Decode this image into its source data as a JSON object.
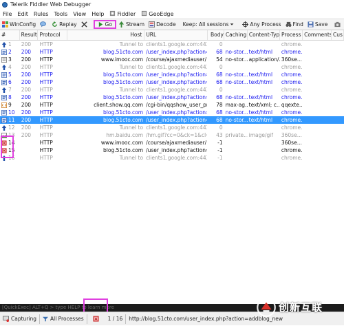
{
  "window": {
    "title": "Telerik Fiddler Web Debugger"
  },
  "menu": [
    "File",
    "Edit",
    "Rules",
    "Tools",
    "View",
    "Help",
    "Fiddler",
    "GeoEdge"
  ],
  "toolbar": {
    "winconfig": "WinConfig",
    "replay": "Replay",
    "go": "Go",
    "stream": "Stream",
    "decode": "Decode",
    "keep": "Keep: All sessions",
    "process": "Any Process",
    "find": "Find",
    "save": "Save"
  },
  "columns": [
    "#",
    "Result",
    "Protocol",
    "Host",
    "URL",
    "Body",
    "Caching",
    "Content-Type",
    "Process",
    "Comments",
    "Cus"
  ],
  "sessions": [
    {
      "id": "1",
      "result": "200",
      "protocol": "HTTP",
      "host": "Tunnel to",
      "url": "clients1.google.com:443",
      "body": "0",
      "caching": "",
      "ctype": "",
      "process": "chrome...",
      "kind": "tunnel",
      "icon": "tunnel"
    },
    {
      "id": "2",
      "result": "200",
      "protocol": "HTTP",
      "host": "blog.51cto.com",
      "url": "/user_index.php?action=...",
      "body": "68",
      "caching": "no-stor...",
      "ctype": "text/html",
      "process": "chrome...",
      "kind": "http",
      "icon": "html"
    },
    {
      "id": "3",
      "result": "200",
      "protocol": "HTTP",
      "host": "www.imooc.com",
      "url": "/course/ajaxmediauser/",
      "body": "54",
      "caching": "no-stor...",
      "ctype": "application/...",
      "process": "360se...",
      "kind": "normal",
      "icon": "json"
    },
    {
      "id": "4",
      "result": "200",
      "protocol": "HTTP",
      "host": "Tunnel to",
      "url": "clients1.google.com:443",
      "body": "0",
      "caching": "",
      "ctype": "",
      "process": "chrome...",
      "kind": "tunnel",
      "icon": "tunnel"
    },
    {
      "id": "5",
      "result": "200",
      "protocol": "HTTP",
      "host": "blog.51cto.com",
      "url": "/user_index.php?action=...",
      "body": "68",
      "caching": "no-stor...",
      "ctype": "text/html",
      "process": "chrome...",
      "kind": "http",
      "icon": "html"
    },
    {
      "id": "6",
      "result": "200",
      "protocol": "HTTP",
      "host": "blog.51cto.com",
      "url": "/user_index.php?action=...",
      "body": "68",
      "caching": "no-stor...",
      "ctype": "text/html",
      "process": "chrome...",
      "kind": "http",
      "icon": "html"
    },
    {
      "id": "7",
      "result": "200",
      "protocol": "HTTP",
      "host": "Tunnel to",
      "url": "clients1.google.com:443",
      "body": "0",
      "caching": "",
      "ctype": "",
      "process": "chrome...",
      "kind": "tunnel",
      "icon": "tunnel"
    },
    {
      "id": "8",
      "result": "200",
      "protocol": "HTTP",
      "host": "blog.51cto.com",
      "url": "/user_index.php?action=...",
      "body": "68",
      "caching": "no-stor...",
      "ctype": "text/html",
      "process": "chrome...",
      "kind": "http",
      "icon": "html"
    },
    {
      "id": "9",
      "result": "200",
      "protocol": "HTTP",
      "host": "client.show.qq.com",
      "url": "/cgi-bin/qqshow_user_pro...",
      "body": "78",
      "caching": "max-ag...",
      "ctype": "text/xml; c...",
      "process": "qqexte...",
      "kind": "normal",
      "icon": "xml"
    },
    {
      "id": "10",
      "result": "200",
      "protocol": "HTTP",
      "host": "blog.51cto.com",
      "url": "/user_index.php?action=...",
      "body": "68",
      "caching": "no-stor...",
      "ctype": "text/html",
      "process": "chrome...",
      "kind": "http",
      "icon": "html"
    },
    {
      "id": "11",
      "result": "200",
      "protocol": "HTTP",
      "host": "blog.51cto.com",
      "url": "/user_index.php?action=...",
      "body": "68",
      "caching": "no-stor...",
      "ctype": "text/html",
      "process": "chrome...",
      "kind": "sel",
      "icon": "html"
    },
    {
      "id": "12",
      "result": "200",
      "protocol": "HTTP",
      "host": "Tunnel to",
      "url": "clients1.google.com:443",
      "body": "0",
      "caching": "",
      "ctype": "",
      "process": "chrome...",
      "kind": "tunnel",
      "icon": "tunnel"
    },
    {
      "id": "13",
      "result": "200",
      "protocol": "HTTP",
      "host": "hm.baidu.com",
      "url": "/hm.gif?cc=0&ck=1&cl=2...",
      "body": "43",
      "caching": "private...",
      "ctype": "image/gif",
      "process": "360se...",
      "kind": "tunnel",
      "icon": "img"
    },
    {
      "id": "14",
      "result": "",
      "protocol": "HTTP",
      "host": "www.imooc.com",
      "url": "/course/ajaxmediauser/",
      "body": "-1",
      "caching": "",
      "ctype": "",
      "process": "360se...",
      "kind": "normal",
      "icon": "paused"
    },
    {
      "id": "15",
      "result": "",
      "protocol": "HTTP",
      "host": "blog.51cto.com",
      "url": "/user_index.php?action=...",
      "body": "-1",
      "caching": "",
      "ctype": "",
      "process": "chrome...",
      "kind": "normal",
      "icon": "paused"
    },
    {
      "id": "16",
      "result": "",
      "protocol": "HTTP",
      "host": "Tunnel to",
      "url": "clients1.google.com:443",
      "body": "-1",
      "caching": "",
      "ctype": "",
      "process": "chrome...",
      "kind": "tunnel",
      "icon": "up"
    }
  ],
  "quickexec": {
    "placeholder": "[QuickExec] ALT+Q > type HELP to learn more"
  },
  "status": {
    "capturing": "Capturing",
    "processes": "All Processes",
    "count": "1 / 16",
    "url": "http://blog.51cto.com/user_index.php?action=addblog_new"
  },
  "watermark": {
    "text": "创新互联"
  },
  "colors": {
    "selection": "#3399ff",
    "highlight": "#e040e0",
    "link": "#1a1af0"
  }
}
